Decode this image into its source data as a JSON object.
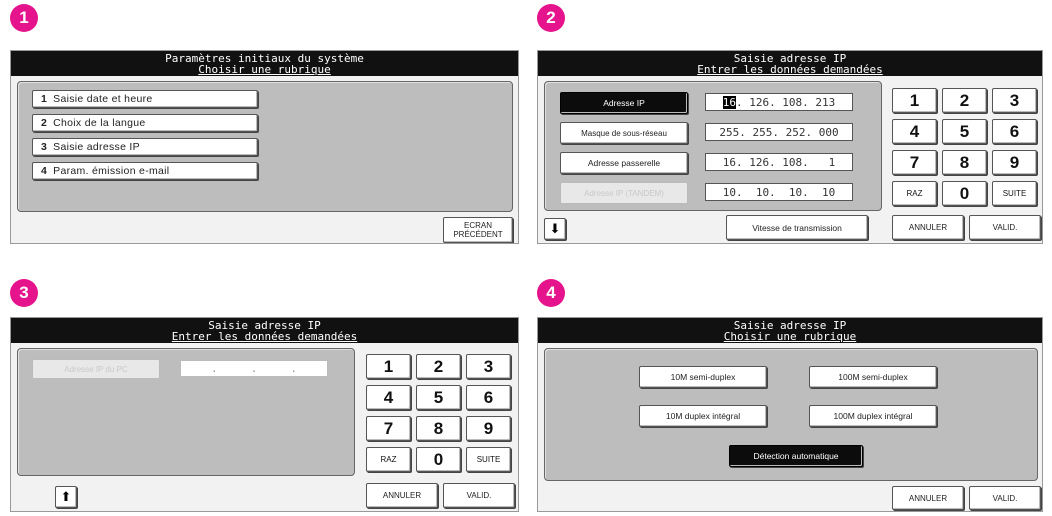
{
  "steps": [
    "1",
    "2",
    "3",
    "4"
  ],
  "screen1": {
    "title": "Paramètres initiaux du système",
    "subtitle": "Choisir une rubrique",
    "menu": [
      {
        "num": "1",
        "label": "Saisie date et heure"
      },
      {
        "num": "2",
        "label": "Choix de la langue"
      },
      {
        "num": "3",
        "label": "Saisie adresse IP"
      },
      {
        "num": "4",
        "label": "Param. émission e-mail"
      }
    ],
    "back_line1": "ECRAN",
    "back_line2": "PRÉCÉDENT"
  },
  "screen2": {
    "title": "Saisie adresse IP",
    "subtitle": "Entrer les données demandées",
    "rows": [
      {
        "label": "Adresse IP",
        "cursor": "16",
        "value": ". 126. 108. 213"
      },
      {
        "label": "Masque de sous-réseau",
        "value": "255. 255. 252. 000"
      },
      {
        "label": "Adresse passerelle",
        "value": "16. 126. 108.   1"
      },
      {
        "label": "Adresse IP (TANDEM)",
        "value": "10.  10.  10.  10"
      }
    ],
    "keys": [
      "1",
      "2",
      "3",
      "4",
      "5",
      "6",
      "7",
      "8",
      "9",
      "RAZ",
      "0",
      "SUITE"
    ],
    "speed_button": "Vitesse de transmission",
    "cancel": "ANNULER",
    "validate": "VALID.",
    "nav_icon": "arrow-down-icon"
  },
  "screen3": {
    "title": "Saisie adresse IP",
    "subtitle": "Entrer les données demandées",
    "row_label": "Adresse IP du PC",
    "row_value": ".     .     .",
    "keys": [
      "1",
      "2",
      "3",
      "4",
      "5",
      "6",
      "7",
      "8",
      "9",
      "RAZ",
      "0",
      "SUITE"
    ],
    "cancel": "ANNULER",
    "validate": "VALID.",
    "nav_icon": "arrow-up-icon"
  },
  "screen4": {
    "title": "Saisie adresse IP",
    "subtitle": "Choisir une rubrique",
    "options": [
      "10M semi-duplex",
      "100M semi-duplex",
      "10M duplex intégral",
      "100M duplex intégral"
    ],
    "auto": "Détection automatique",
    "cancel": "ANNULER",
    "validate": "VALID."
  }
}
